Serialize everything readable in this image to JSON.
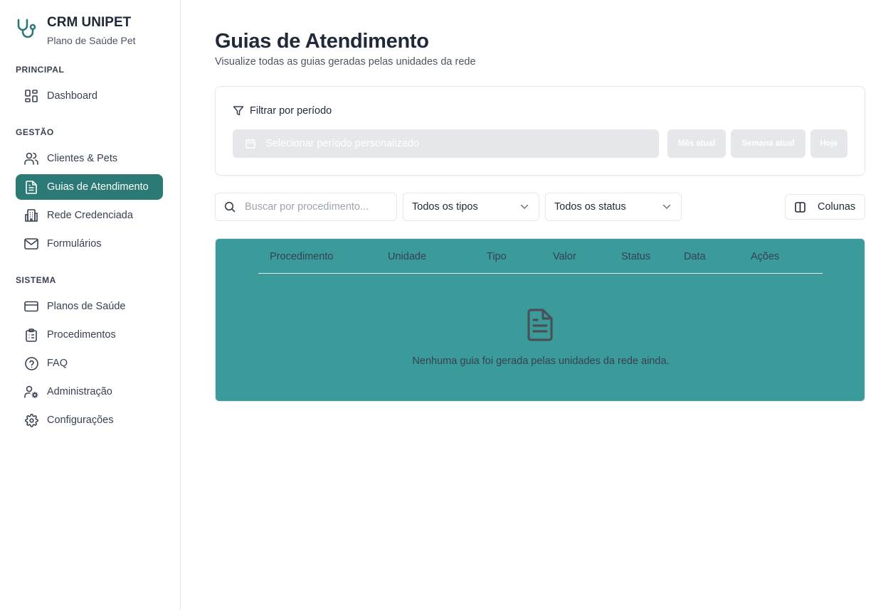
{
  "brand": {
    "title": "CRM UNIPET",
    "subtitle": "Plano de Saúde Pet",
    "icon": "stethoscope-icon"
  },
  "sidebar": {
    "sections": [
      {
        "label": "PRINCIPAL",
        "items": [
          {
            "label": "Dashboard",
            "icon": "dashboard-icon"
          }
        ]
      },
      {
        "label": "GESTÃO",
        "items": [
          {
            "label": "Clientes & Pets",
            "icon": "users-icon"
          },
          {
            "label": "Guias de Atendimento",
            "icon": "file-text-icon",
            "active": true
          },
          {
            "label": "Rede Credenciada",
            "icon": "building-icon"
          },
          {
            "label": "Formulários",
            "icon": "mail-icon"
          }
        ]
      },
      {
        "label": "SISTEMA",
        "items": [
          {
            "label": "Planos de Saúde",
            "icon": "credit-card-icon"
          },
          {
            "label": "Procedimentos",
            "icon": "clipboard-icon"
          },
          {
            "label": "FAQ",
            "icon": "help-circle-icon"
          },
          {
            "label": "Administração",
            "icon": "user-cog-icon"
          },
          {
            "label": "Configurações",
            "icon": "gear-icon"
          }
        ]
      }
    ],
    "active_color": "#2b7a75"
  },
  "page": {
    "title": "Guias de Atendimento",
    "subtitle": "Visualize todas as guias geradas pelas unidades da rede"
  },
  "filter": {
    "heading": "Filtrar por período",
    "period_placeholder": "Selecionar período personalizado",
    "quick": [
      "Mês atual",
      "Semana atual",
      "Hoje"
    ]
  },
  "toolbar": {
    "search_placeholder": "Buscar por procedimento...",
    "type_select": "Todos os tipos",
    "status_select": "Todos os status",
    "columns_label": "Colunas"
  },
  "table": {
    "columns": [
      "Procedimento",
      "Unidade",
      "Tipo",
      "Valor",
      "Status",
      "Data",
      "Ações"
    ],
    "empty_message": "Nenhuma guia foi gerada pelas unidades da rede ainda.",
    "background": "#3a9b9a"
  }
}
